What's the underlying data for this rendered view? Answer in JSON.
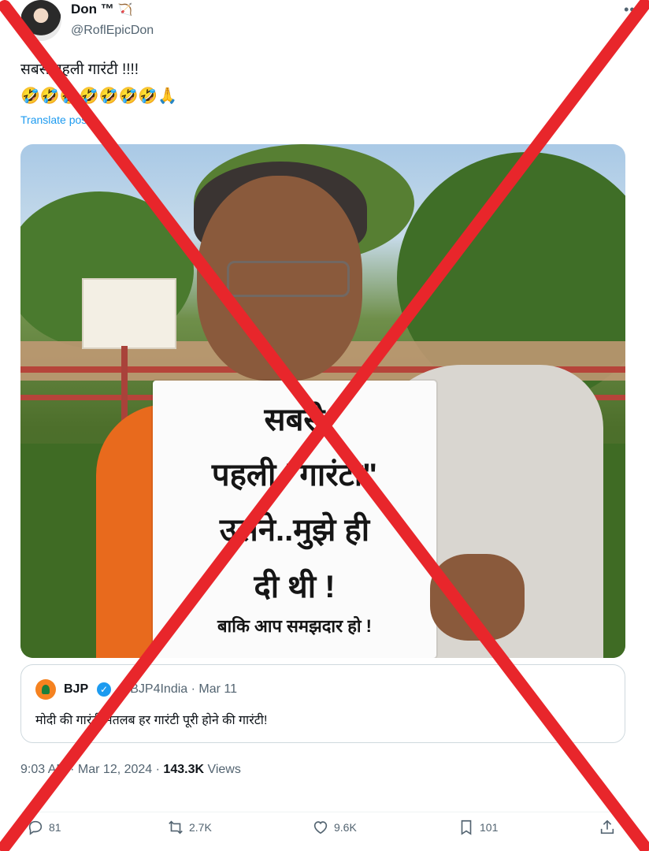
{
  "author": {
    "name": "Don ™",
    "handle": "@RoflEpicDon",
    "name_badge_icon": "bow-arrow-icon"
  },
  "tweet": {
    "text": "सबसे पहली गारंटी !!!!",
    "emojis": "🤣🤣🤣🤣🤣🤣🤣🙏",
    "translate_label": "Translate post"
  },
  "media": {
    "placard_lines": [
      "सबसे",
      "पहली \"गारंटी\"",
      "उसने..मुझे ही",
      "दी थी !",
      "बाकि आप समझदार हो !"
    ]
  },
  "quoted": {
    "name": "BJP",
    "handle_time": "@BJP4India · Mar 11",
    "text": "मोदी की गारंटी मतलब हर गारंटी पूरी होने की गारंटी!"
  },
  "meta": {
    "time_date": "9:03 AM · Mar 12, 2024 · ",
    "views_count": "143.3K",
    "views_label": " Views"
  },
  "actions": {
    "replies": "81",
    "reposts": "2.7K",
    "likes": "9.6K",
    "bookmarks": "101"
  },
  "colors": {
    "link": "#1d9bf0",
    "overlay_x": "#e8262b",
    "secondary_text": "#536471"
  }
}
